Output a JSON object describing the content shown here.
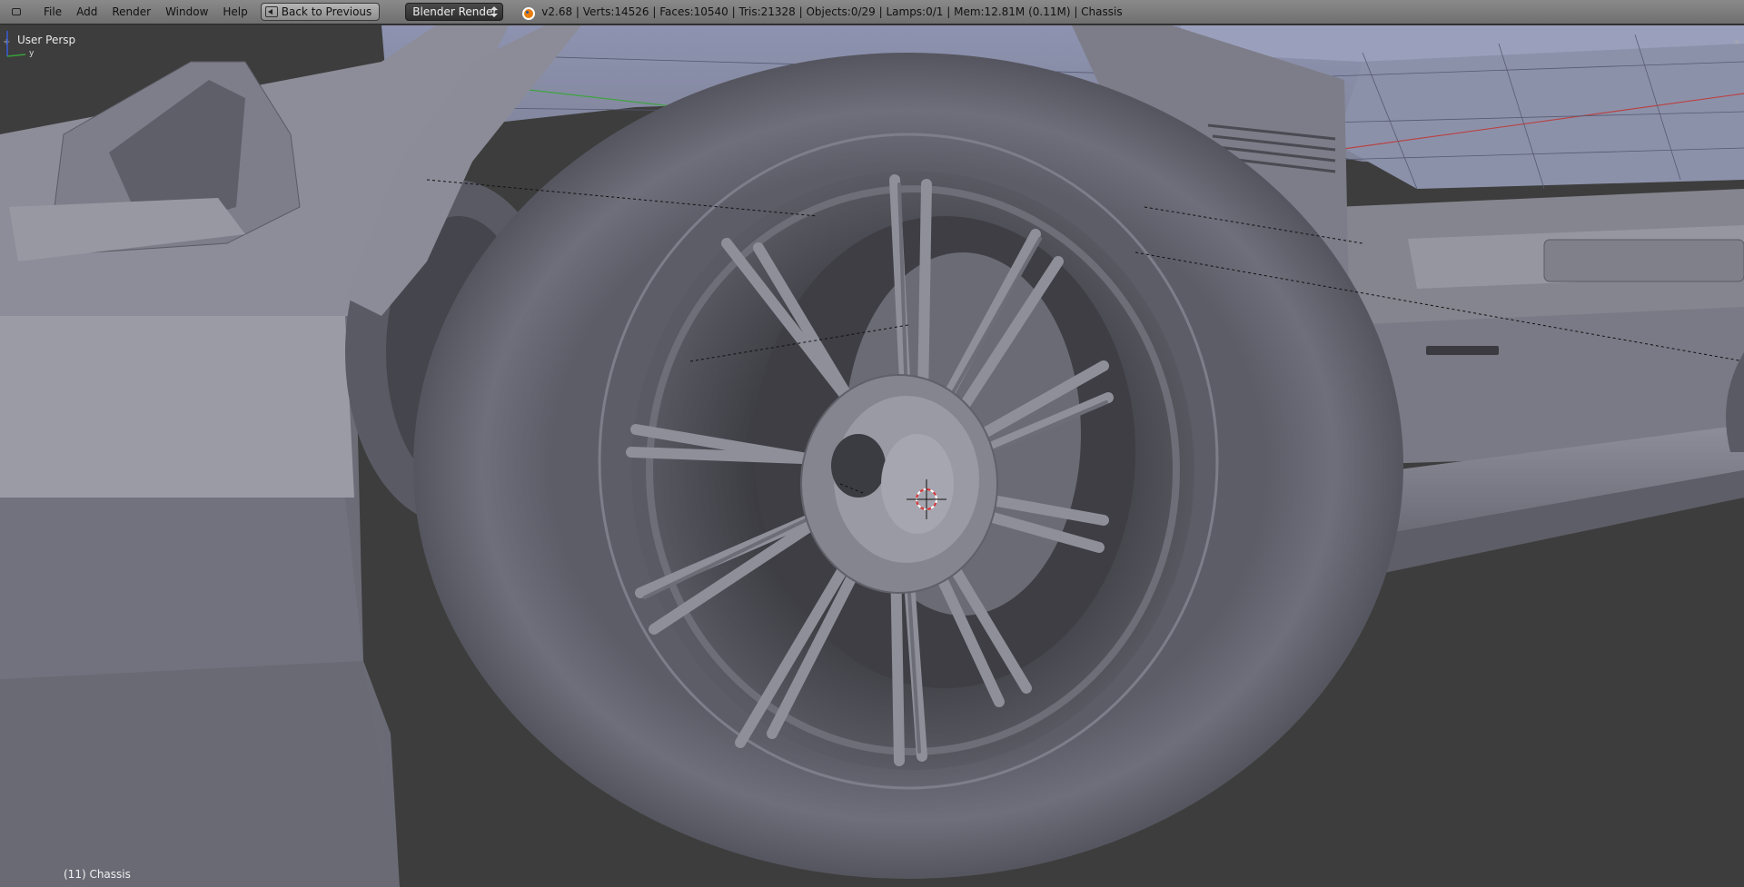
{
  "header": {
    "menus": [
      {
        "label": "File"
      },
      {
        "label": "Add"
      },
      {
        "label": "Render"
      },
      {
        "label": "Window"
      },
      {
        "label": "Help"
      }
    ],
    "back_button_label": "Back to Previous",
    "render_engine": "Blender Render",
    "stats": "v2.68 | Verts:14526 | Faces:10540 | Tris:21328 | Objects:0/29 | Lamps:0/1 | Mem:12.81M (0.11M) | Chassis"
  },
  "viewport": {
    "view_label": "User Persp",
    "object_label": "(11) Chassis",
    "axis_y_label": "y"
  },
  "colors": {
    "background": "#393939",
    "header": "#7d7d7d",
    "mesh": "#8a8a96",
    "grid_red": "#c04040",
    "grid_green": "#40a040"
  }
}
